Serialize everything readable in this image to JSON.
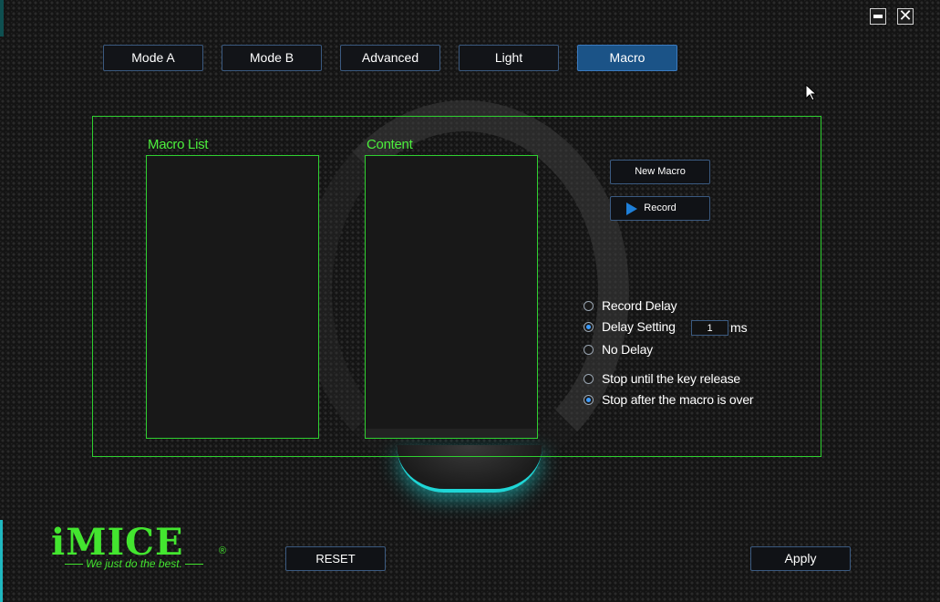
{
  "window": {
    "minimize_icon": "minimize-icon",
    "close_icon": "close-icon",
    "close_glyph": "✕"
  },
  "tabs": [
    {
      "label": "Mode A",
      "active": false
    },
    {
      "label": "Mode B",
      "active": false
    },
    {
      "label": "Advanced",
      "active": false
    },
    {
      "label": "Light",
      "active": false
    },
    {
      "label": "Macro",
      "active": true
    }
  ],
  "macro_list": {
    "title": "Macro List",
    "items": []
  },
  "content_list": {
    "title": "Content",
    "items": []
  },
  "actions": {
    "new_macro_label": "New Macro",
    "record_label": "Record",
    "record_icon": "play-icon"
  },
  "delay_options": {
    "record_delay": {
      "label": "Record Delay",
      "checked": false
    },
    "delay_setting": {
      "label": "Delay Setting",
      "checked": true,
      "value": "1",
      "unit": "ms"
    },
    "no_delay": {
      "label": "No Delay",
      "checked": false
    }
  },
  "stop_options": {
    "until_release": {
      "label": "Stop until the key release",
      "checked": false
    },
    "after_over": {
      "label": "Stop after the macro is over",
      "checked": true
    }
  },
  "brand": {
    "logo": "iMICE",
    "registered": "®",
    "tagline": "We just do the best."
  },
  "footer": {
    "reset_label": "RESET",
    "apply_label": "Apply"
  },
  "colors": {
    "accent_green": "#2fd030",
    "active_tab": "#1b5387",
    "button_border": "#3b5a80",
    "glow": "#1fd6d6"
  }
}
